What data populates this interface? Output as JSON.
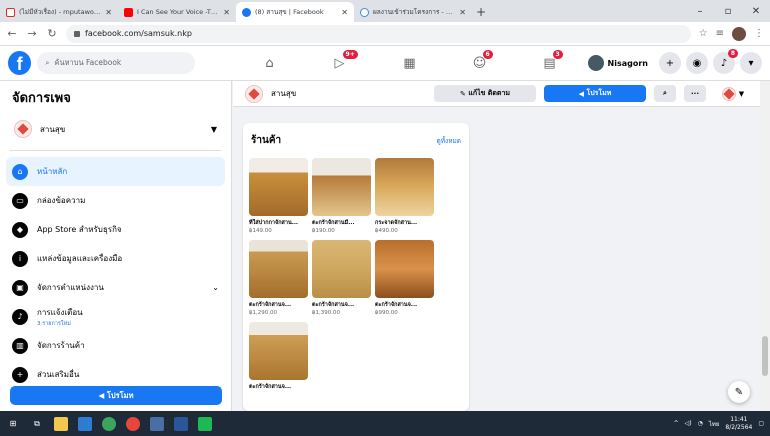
{
  "browser": {
    "tabs": [
      {
        "title": "(ไม่มีหัวเรื่อง) - rnputawong@gmail",
        "favicon": "gmail-icon",
        "active": false
      },
      {
        "title": "I Can See Your Voice -TH | EP.80",
        "favicon": "youtube-icon",
        "active": false
      },
      {
        "title": "(8) สานสุข | Facebook",
        "favicon": "facebook-icon",
        "active": true
      },
      {
        "title": "ผลงานเข้าร่วมโครงการ - ค้นหาด้วย",
        "favicon": "google-icon",
        "active": false
      }
    ],
    "url": "facebook.com/samsuk.nkp"
  },
  "fbnav": {
    "search_placeholder": "ค้นหาบน Facebook",
    "badges": {
      "watch": "9+",
      "gaming": "6",
      "pages": "3",
      "notifications": "8"
    },
    "user_name": "Nisagorn"
  },
  "sidebar": {
    "title": "จัดการเพจ",
    "page_name": "สานสุข",
    "items": [
      {
        "label": "หน้าหลัก",
        "icon": "home-icon",
        "active": true
      },
      {
        "label": "กล่องข้อความ",
        "icon": "inbox-icon"
      },
      {
        "label": "App Store สำหรับธุรกิจ",
        "icon": "app-store-icon"
      },
      {
        "label": "แหล่งข้อมูลและเครื่องมือ",
        "icon": "info-icon"
      },
      {
        "label": "จัดการตำแหน่งงาน",
        "icon": "jobs-icon",
        "has_chevron": true
      },
      {
        "label": "การแจ้งเตือน",
        "icon": "bell-icon",
        "subtext": "3 รายการใหม่"
      },
      {
        "label": "จัดการร้านค้า",
        "icon": "shop-icon"
      },
      {
        "label": "ส่วนเสริมอื่น",
        "icon": "more-icon"
      }
    ],
    "promote_label": "โปรโมท"
  },
  "pagebar": {
    "page_name": "สานสุข",
    "edit_label": "แก้ไข ติดตาม",
    "promote_label": "โปรโมท"
  },
  "shop": {
    "title": "ร้านค้า",
    "see_all": "ดูทั้งหมด",
    "products": [
      {
        "name": "ที่ใส่ปากกาจักสาน...",
        "price": "฿149.00"
      },
      {
        "name": "ตะกร้าจักสานมี...",
        "price": "฿190.00"
      },
      {
        "name": "กระจาดจักสาน...",
        "price": "฿490.00"
      },
      {
        "name": "ตะกร้าจักสานจ...",
        "price": "฿1,290.00"
      },
      {
        "name": "ตะกร้าจักสานจ...",
        "price": "฿1,390.00"
      },
      {
        "name": "ตะกร้าจักสานจ...",
        "price": "฿990.00"
      },
      {
        "name": "ตะกร้าจักสานจ...",
        "price": ""
      }
    ]
  },
  "taskbar": {
    "lang": "ไทย",
    "time": "11:41",
    "date": "8/2/2564"
  },
  "colors": {
    "fb_blue": "#1877f2",
    "badge_red": "#e41e3f"
  }
}
